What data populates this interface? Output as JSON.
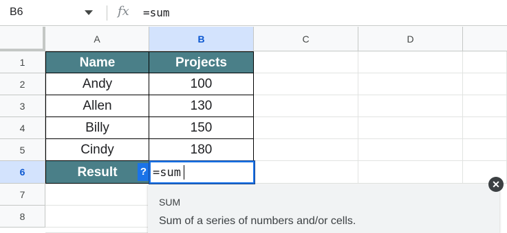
{
  "formula_bar": {
    "name_box": "B6",
    "fx_label": "fx",
    "formula": "=sum"
  },
  "columns": [
    "A",
    "B",
    "C",
    "D"
  ],
  "rows": [
    "1",
    "2",
    "3",
    "4",
    "5",
    "6",
    "7",
    "8"
  ],
  "table": {
    "header": {
      "name": "Name",
      "projects": "Projects"
    },
    "data": [
      {
        "name": "Andy",
        "projects": "100"
      },
      {
        "name": "Allen",
        "projects": "130"
      },
      {
        "name": "Billy",
        "projects": "150"
      },
      {
        "name": "Cindy",
        "projects": "180"
      }
    ],
    "result_label": "Result"
  },
  "active_cell": {
    "ref": "B6",
    "value": "=sum"
  },
  "help_badge": "?",
  "autocomplete": {
    "function_name": "SUM",
    "description": "Sum of a series of numbers and/or cells."
  },
  "colors": {
    "header_fill": "#4a7f88",
    "selection": "#1a73e8",
    "selected_header": "#d3e3fd"
  }
}
